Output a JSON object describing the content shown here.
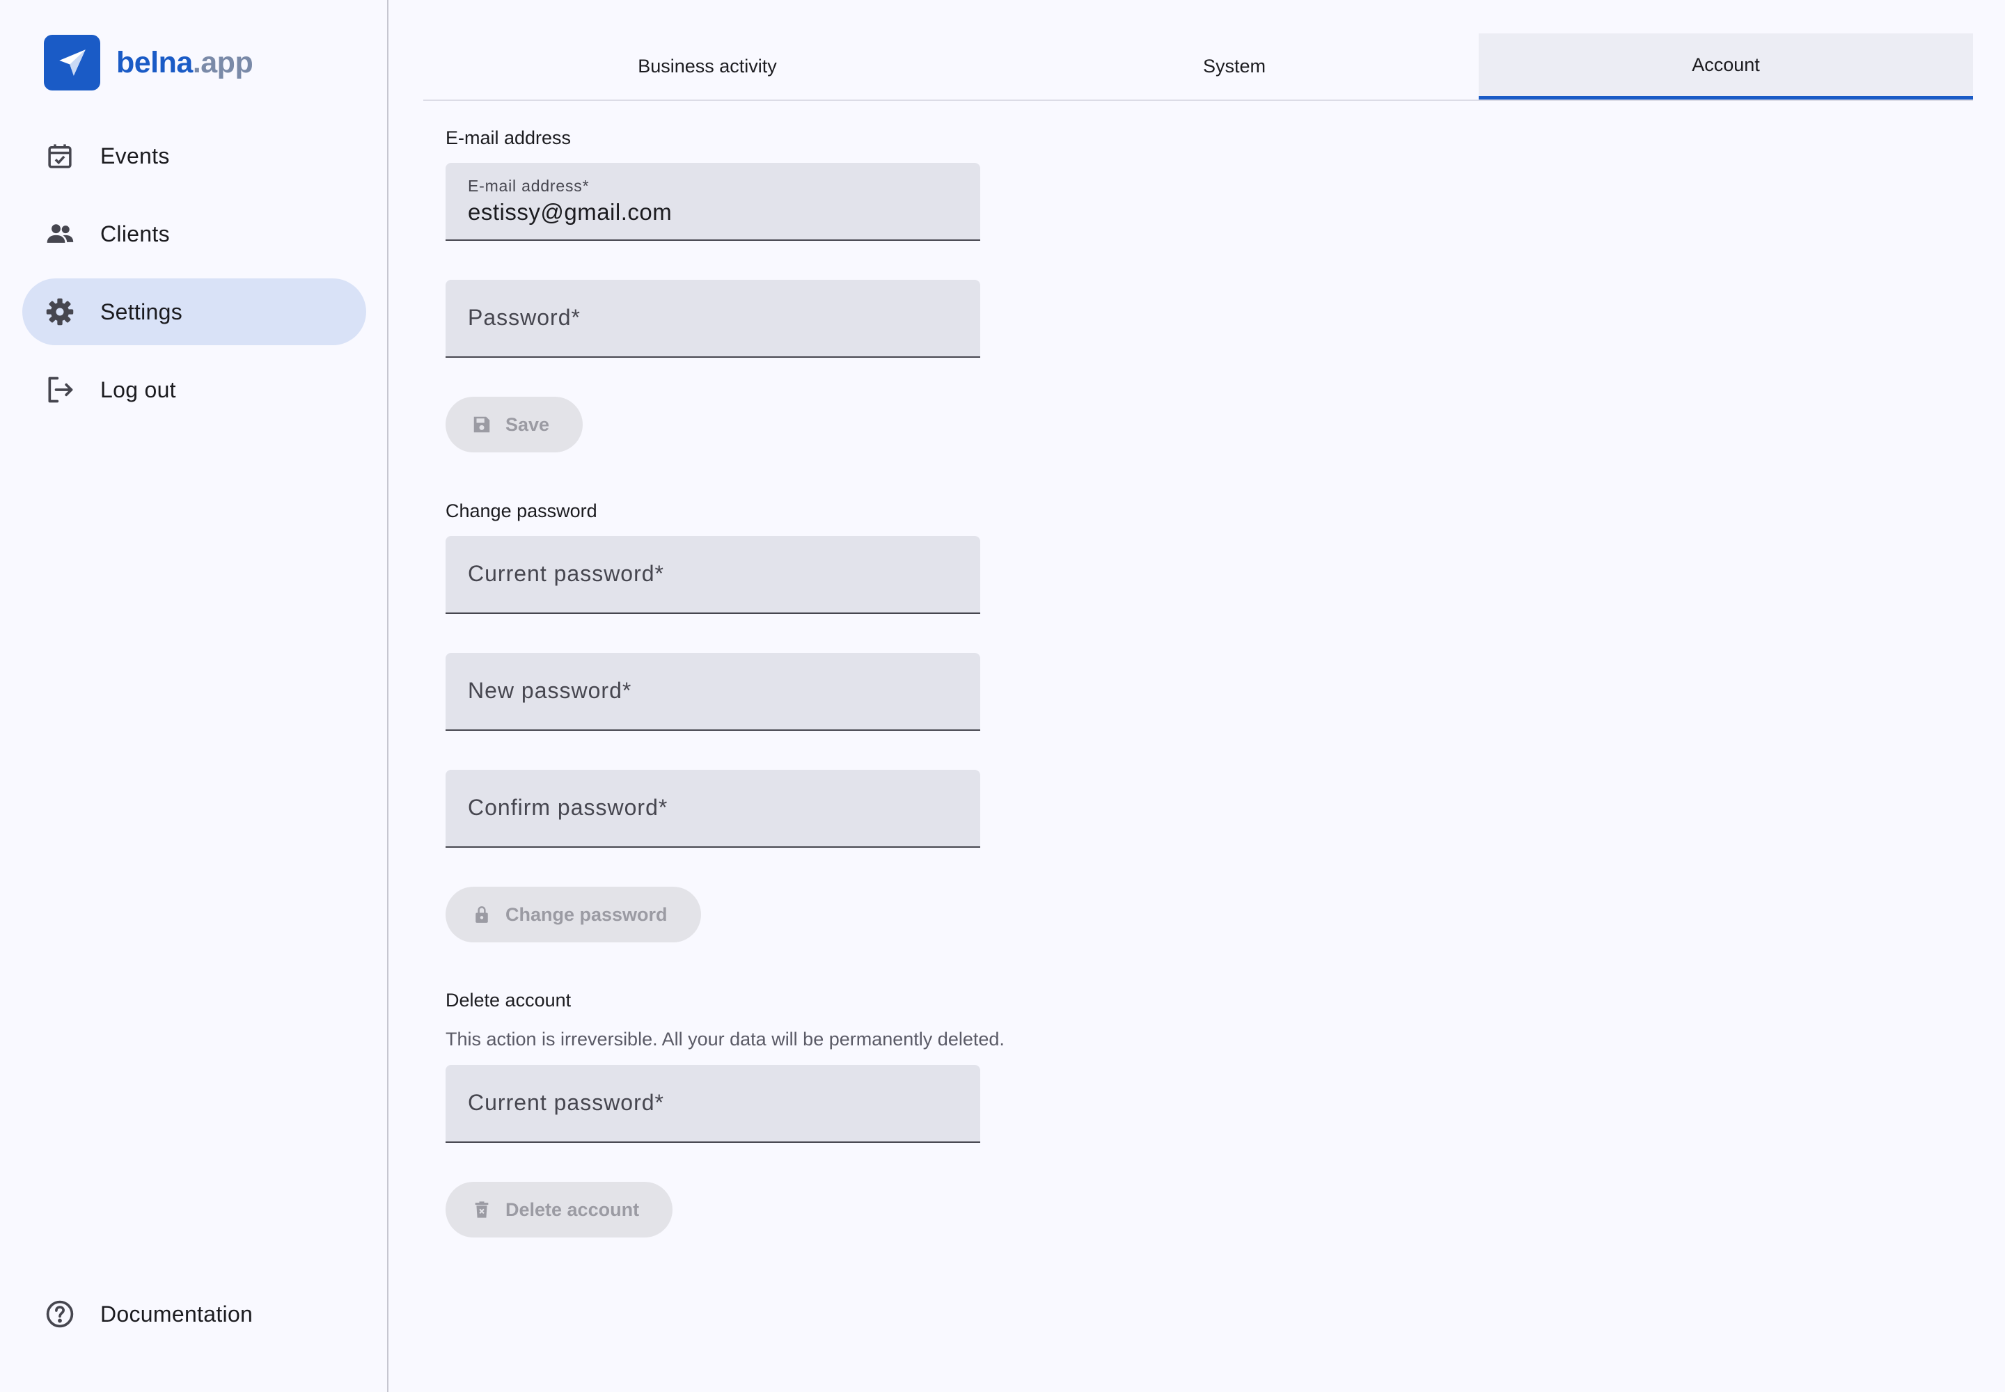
{
  "brand": {
    "name_part1": "belna",
    "name_part2": ".app",
    "accent": "#1a5bc6"
  },
  "sidebar": {
    "items": [
      {
        "label": "Events",
        "icon": "calendar-check-icon"
      },
      {
        "label": "Clients",
        "icon": "people-icon"
      },
      {
        "label": "Settings",
        "icon": "gear-icon",
        "active": true
      },
      {
        "label": "Log out",
        "icon": "logout-icon"
      }
    ],
    "footer_item": {
      "label": "Documentation",
      "icon": "help-circle-icon"
    }
  },
  "tabs": [
    {
      "label": "Business activity"
    },
    {
      "label": "System"
    },
    {
      "label": "Account",
      "active": true
    }
  ],
  "email_section": {
    "title": "E-mail address",
    "email_field": {
      "label": "E-mail address*",
      "value": "estissy@gmail.com"
    },
    "password_field": {
      "placeholder": "Password*"
    },
    "save_button": "Save"
  },
  "change_password_section": {
    "title": "Change password",
    "current_password": "Current password*",
    "new_password": "New password*",
    "confirm_password": "Confirm password*",
    "button": "Change password"
  },
  "delete_section": {
    "title": "Delete account",
    "description": "This action is irreversible. All your data will be permanently deleted.",
    "current_password": "Current password*",
    "button": "Delete account"
  }
}
